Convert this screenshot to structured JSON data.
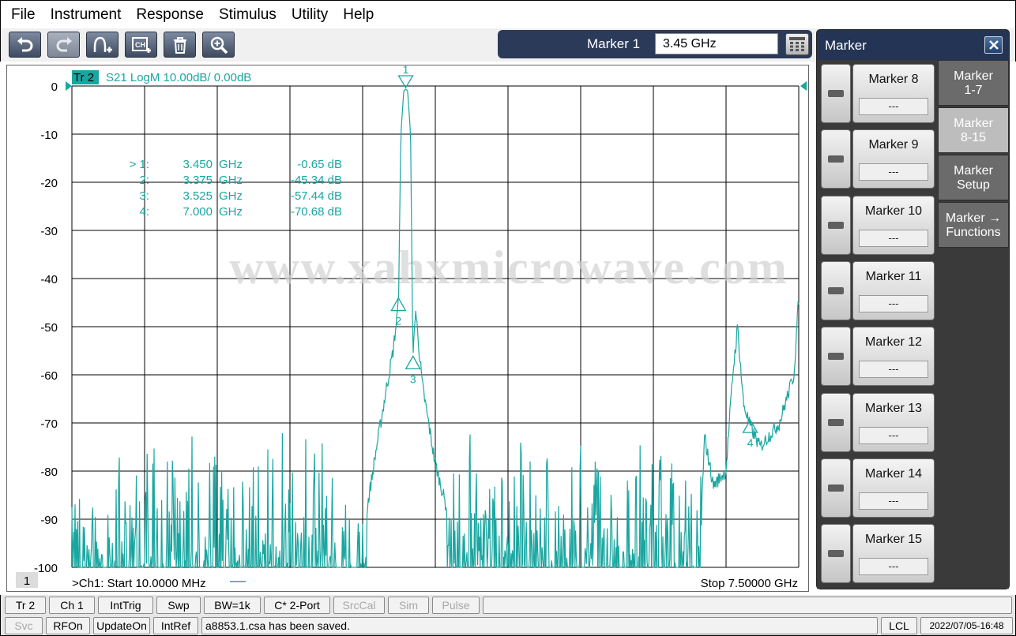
{
  "menu": [
    "File",
    "Instrument",
    "Response",
    "Stimulus",
    "Utility",
    "Help"
  ],
  "toolbar": {
    "icons": [
      "undo-icon",
      "redo-icon",
      "add-trace-icon",
      "add-channel-icon",
      "delete-icon",
      "zoom-icon"
    ],
    "entry_label": "Marker 1",
    "entry_value": "3.45 GHz"
  },
  "chart": {
    "trace_tag": "Tr 2",
    "trace_info": "S21 LogM 10.00dB/  0.00dB",
    "window_number": "1",
    "start_label": ">Ch1:  Start  10.0000 MHz",
    "stop_label": "Stop  7.50000 GHz",
    "watermark": "www.xahxmicrowave.com",
    "y_ticks": [
      "0",
      "-10",
      "-20",
      "-30",
      "-40",
      "-50",
      "-60",
      "-70",
      "-80",
      "-90",
      "-100"
    ],
    "marker_table": [
      {
        "prefix": "> 1:",
        "freq": "3.450",
        "unit": "GHz",
        "value": "-0.65 dB"
      },
      {
        "prefix": "2:",
        "freq": "3.375",
        "unit": "GHz",
        "value": "-45.34 dB"
      },
      {
        "prefix": "3:",
        "freq": "3.525",
        "unit": "GHz",
        "value": "-57.44 dB"
      },
      {
        "prefix": "4:",
        "freq": "7.000",
        "unit": "GHz",
        "value": "-70.68 dB"
      }
    ],
    "marker_labels": [
      "1",
      "2",
      "3",
      "4"
    ]
  },
  "chart_data": {
    "type": "line",
    "series": [
      {
        "name": "S21 LogM"
      }
    ],
    "x_range_ghz": [
      0.01,
      7.5
    ],
    "ylim": [
      -100,
      0
    ],
    "y_ticks": [
      0,
      -10,
      -20,
      -30,
      -40,
      -50,
      -60,
      -70,
      -80,
      -90,
      -100
    ],
    "grid": true,
    "points": [
      [
        0.01,
        -86
      ],
      [
        0.05,
        -100
      ],
      [
        0.5,
        -100
      ],
      [
        1.0,
        -100
      ],
      [
        2.0,
        -100
      ],
      [
        2.9,
        -99
      ],
      [
        3.05,
        -88
      ],
      [
        3.15,
        -75
      ],
      [
        3.25,
        -63
      ],
      [
        3.32,
        -55
      ],
      [
        3.375,
        -45.34
      ],
      [
        3.4,
        -10
      ],
      [
        3.43,
        -1
      ],
      [
        3.45,
        -0.65
      ],
      [
        3.47,
        -1
      ],
      [
        3.5,
        -10
      ],
      [
        3.525,
        -57.44
      ],
      [
        3.55,
        -46
      ],
      [
        3.62,
        -62
      ],
      [
        3.75,
        -78
      ],
      [
        3.9,
        -90
      ],
      [
        4.1,
        -100
      ],
      [
        5.0,
        -100
      ],
      [
        6.0,
        -99
      ],
      [
        6.48,
        -97
      ],
      [
        6.53,
        -73
      ],
      [
        6.62,
        -83
      ],
      [
        6.75,
        -80
      ],
      [
        6.82,
        -60
      ],
      [
        6.87,
        -50
      ],
      [
        6.93,
        -66
      ],
      [
        7.0,
        -70.68
      ],
      [
        7.1,
        -75
      ],
      [
        7.3,
        -70
      ],
      [
        7.45,
        -60
      ],
      [
        7.5,
        -44
      ]
    ],
    "markers": [
      {
        "id": 1,
        "x": 3.45,
        "y": -0.65
      },
      {
        "id": 2,
        "x": 3.375,
        "y": -45.34
      },
      {
        "id": 3,
        "x": 3.525,
        "y": -57.44
      },
      {
        "id": 4,
        "x": 7.0,
        "y": -70.68
      }
    ]
  },
  "panel": {
    "title": "Marker",
    "markers": [
      {
        "label": "Marker 8",
        "value": "---"
      },
      {
        "label": "Marker 9",
        "value": "---"
      },
      {
        "label": "Marker 10",
        "value": "---"
      },
      {
        "label": "Marker 11",
        "value": "---"
      },
      {
        "label": "Marker 12",
        "value": "---"
      },
      {
        "label": "Marker 13",
        "value": "---"
      },
      {
        "label": "Marker 14",
        "value": "---"
      },
      {
        "label": "Marker 15",
        "value": "---"
      }
    ],
    "tabs": [
      {
        "line1": "Marker",
        "line2": "1-7",
        "active": false
      },
      {
        "line1": "Marker",
        "line2": "8-15",
        "active": true
      },
      {
        "line1": "Marker",
        "line2": "Setup",
        "active": false
      },
      {
        "line1": "Marker →",
        "line2": "Functions",
        "active": false
      }
    ]
  },
  "status_bar_1": [
    "Tr 2",
    "Ch 1",
    "IntTrig",
    "Swp",
    "BW=1k",
    "C* 2-Port",
    "SrcCal",
    "Sim",
    "Pulse"
  ],
  "status_bar_2": {
    "items": [
      "Svc",
      "RFOn",
      "UpdateOn",
      "IntRef"
    ],
    "message": "a8853.1.csa has been saved.",
    "lcl": "LCL",
    "datetime": "2022/07/05-16:48"
  },
  "colors": {
    "trace": "#1aa6a0",
    "grid": "#000000",
    "accent": "#243455"
  }
}
